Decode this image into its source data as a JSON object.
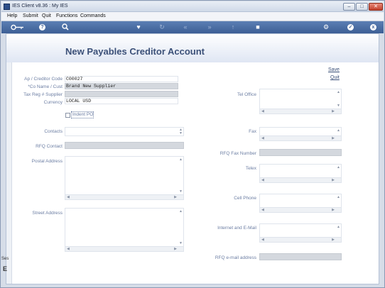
{
  "window": {
    "title": "IES Client v8.36 : My IES"
  },
  "window_controls": {
    "minimize": "–",
    "maximize": "□",
    "close": "✕"
  },
  "menu": [
    "Help",
    "Submit",
    "Quit",
    "Functions",
    "Commands"
  ],
  "toolbar": {
    "icons": [
      "key-icon",
      "help-icon",
      "search-icon",
      "heart-icon",
      "refresh-icon",
      "rewind-icon",
      "forward-icon",
      "upload-icon",
      "stop-icon",
      "gear-icon",
      "check-icon",
      "close-icon"
    ],
    "help_glyph": "?",
    "check_glyph": "✓",
    "close_glyph": "x"
  },
  "page": {
    "title": "New Payables Creditor Account",
    "save_label": "Save",
    "quit_label": "Quit"
  },
  "form": {
    "labels": {
      "code": "Ap / Creditor Code",
      "name": "*Co Name / Cust",
      "taxreg": "Tax Reg # Supplier",
      "currency": "Currency",
      "indent_po": "Indent PO",
      "contacts": "Contacts",
      "rfq_contact": "RFQ Contact",
      "postal": "Postal Address",
      "street": "Street Address",
      "tel_office": "Tel Office",
      "fax": "Fax",
      "rfq_fax": "RFQ Fax Number",
      "telex": "Telex",
      "cell": "Cell Phone",
      "internet": "Internet and E-Mail",
      "rfq_email": "RFQ e-mail address"
    },
    "values": {
      "code": "C00027",
      "name": "Brand New Supplier",
      "taxreg": "",
      "currency": "LOCAL USD",
      "indent_po_checked": false
    }
  },
  "footer": {
    "left_text": "Ses",
    "left_glyph": "E"
  }
}
